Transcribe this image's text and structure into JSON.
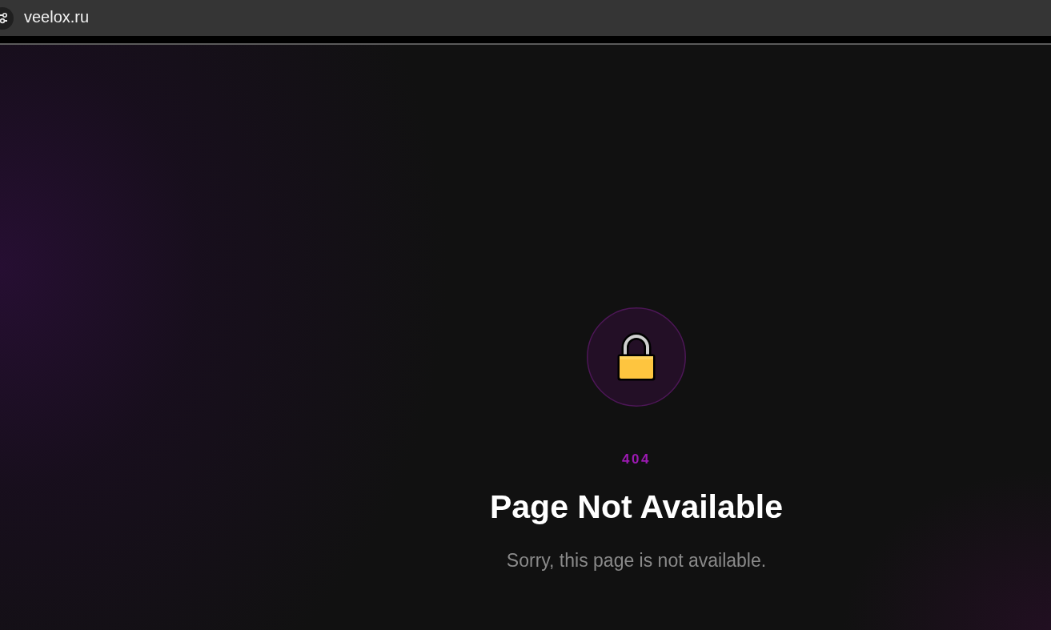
{
  "browser": {
    "address": "veelox.ru"
  },
  "error": {
    "code": "404",
    "title": "Page Not Available",
    "message": "Sorry, this page is not available."
  }
}
